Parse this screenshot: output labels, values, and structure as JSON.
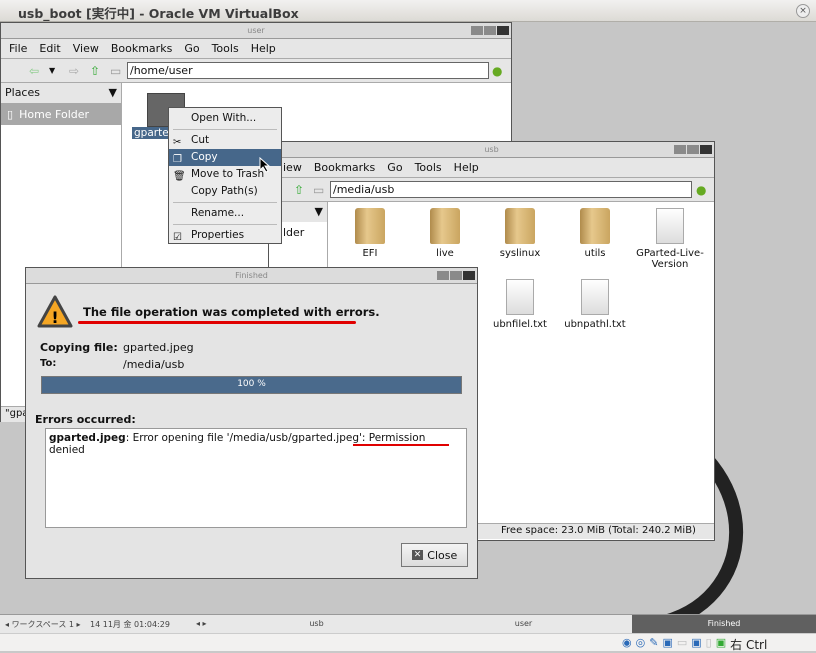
{
  "vbox": {
    "title": "usb_boot [実行中] - Oracle VM VirtualBox",
    "close": "×",
    "host_key": "右 Ctrl"
  },
  "win_user": {
    "title": "user",
    "menu": [
      "File",
      "Edit",
      "View",
      "Bookmarks",
      "Go",
      "Tools",
      "Help"
    ],
    "location": "/home/user",
    "places_label": "Places",
    "home_folder": "Home Folder",
    "file": "gparted.jpeg",
    "file_short": "gparte",
    "status": "\"gpa"
  },
  "context_menu": {
    "items": [
      {
        "label": "Open With..."
      },
      {
        "label": "Cut",
        "icon": "scissors-icon"
      },
      {
        "label": "Copy",
        "icon": "copy-icon",
        "selected": true
      },
      {
        "label": "Move to Trash",
        "icon": "trash-icon"
      },
      {
        "label": "Copy Path(s)"
      },
      {
        "label": "Rename..."
      },
      {
        "label": "Properties",
        "icon": "properties-icon"
      }
    ]
  },
  "win_usb": {
    "title": "usb",
    "menu": [
      "iew",
      "Bookmarks",
      "Go",
      "Tools",
      "Help"
    ],
    "location": "/media/usb",
    "side_item": "lder",
    "files": [
      {
        "name": "EFI",
        "type": "folder"
      },
      {
        "name": "live",
        "type": "folder"
      },
      {
        "name": "syslinux",
        "type": "folder"
      },
      {
        "name": "utils",
        "type": "folder"
      },
      {
        "name": "GParted-Live-Version",
        "type": "doc"
      },
      {
        "name": "ubnfilel.txt",
        "type": "doc"
      },
      {
        "name": "ubnpathl.txt",
        "type": "doc"
      }
    ],
    "status": "Free space: 23.0 MiB (Total: 240.2 MiB)"
  },
  "dialog": {
    "title": "Finished",
    "heading": "The file operation was completed with errors.",
    "copying_label": "Copying file:",
    "copying_value": "gparted.jpeg",
    "to_label": "To:",
    "to_value": "/media/usb",
    "progress_text": "100 %",
    "progress": 100,
    "errors_label": "Errors occurred:",
    "error_file": "gparted.jpeg",
    "error_msg": ": Error opening file '/media/usb/gparted.jpeg': ",
    "error_reason": "Permission denied",
    "close_label": "Close",
    "accent": "#4a6a8c",
    "underline_color": "#e00000"
  },
  "taskbar": {
    "workspace": "ワークスペース 1",
    "date": "14 11月 金 01:04:29",
    "tasks": [
      "usb",
      "user",
      "Finished"
    ]
  }
}
